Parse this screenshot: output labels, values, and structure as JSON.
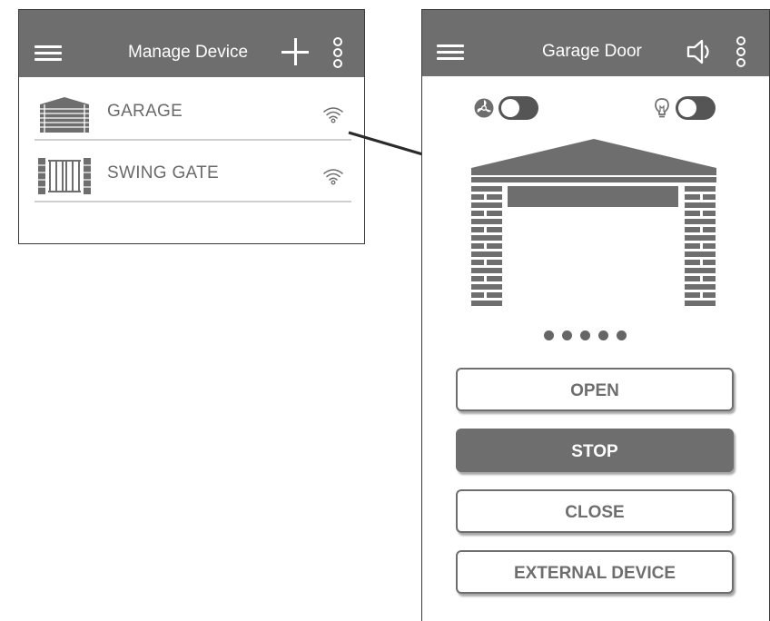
{
  "manage_screen": {
    "title": "Manage Device",
    "menu_icon": "hamburger-menu-icon",
    "add_icon": "plus-icon",
    "more_icon": "vertical-dots-icon",
    "devices": [
      {
        "label": "GARAGE",
        "icon": "garage-door-icon",
        "status_icon": "wifi-signal-icon"
      },
      {
        "label": "SWING GATE",
        "icon": "swing-gate-icon",
        "status_icon": "wifi-signal-icon"
      }
    ]
  },
  "device_screen": {
    "title": "Garage Door",
    "menu_icon": "hamburger-menu-icon",
    "sound_icon": "speaker-icon",
    "more_icon": "vertical-dots-icon",
    "toggles": [
      {
        "icon": "fan-icon",
        "state": "off"
      },
      {
        "icon": "lightbulb-icon",
        "state": "off"
      }
    ],
    "pager": {
      "count": 5
    },
    "buttons": [
      {
        "label": "OPEN",
        "active": false
      },
      {
        "label": "STOP",
        "active": true
      },
      {
        "label": "CLOSE",
        "active": false
      },
      {
        "label": "EXTERNAL DEVICE",
        "active": false
      }
    ]
  },
  "colors": {
    "bar": "#6e6e6e",
    "text": "#6a6a6a",
    "divider": "#cfcfcf"
  }
}
